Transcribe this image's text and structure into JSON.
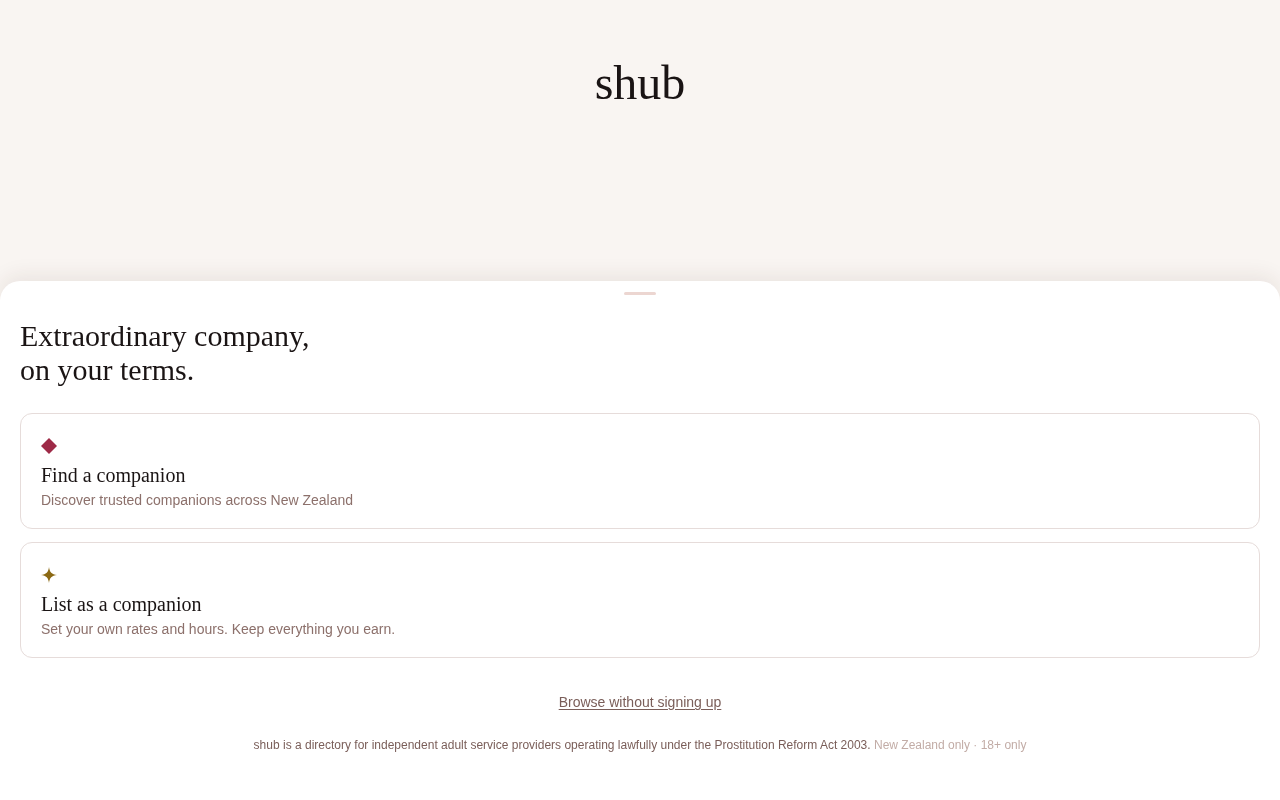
{
  "logo": "shub",
  "sheet": {
    "heading": "Extraordinary company,\non your terms.",
    "options": [
      {
        "kind": "diamond",
        "color": "#9e2a47",
        "title": "Find a companion",
        "description": "Discover trusted companions across New Zealand"
      },
      {
        "kind": "sparkle",
        "color": "#8b6914",
        "title": "List as a companion",
        "description": "Set your own rates and hours. Keep everything you earn."
      }
    ],
    "browse_link": "Browse without signing up",
    "footer": {
      "disclaimer": "shub is a directory for independent adult service providers operating lawfully under the Prostitution Reform Act 2003.",
      "note": "New Zealand only · 18+ only"
    }
  }
}
